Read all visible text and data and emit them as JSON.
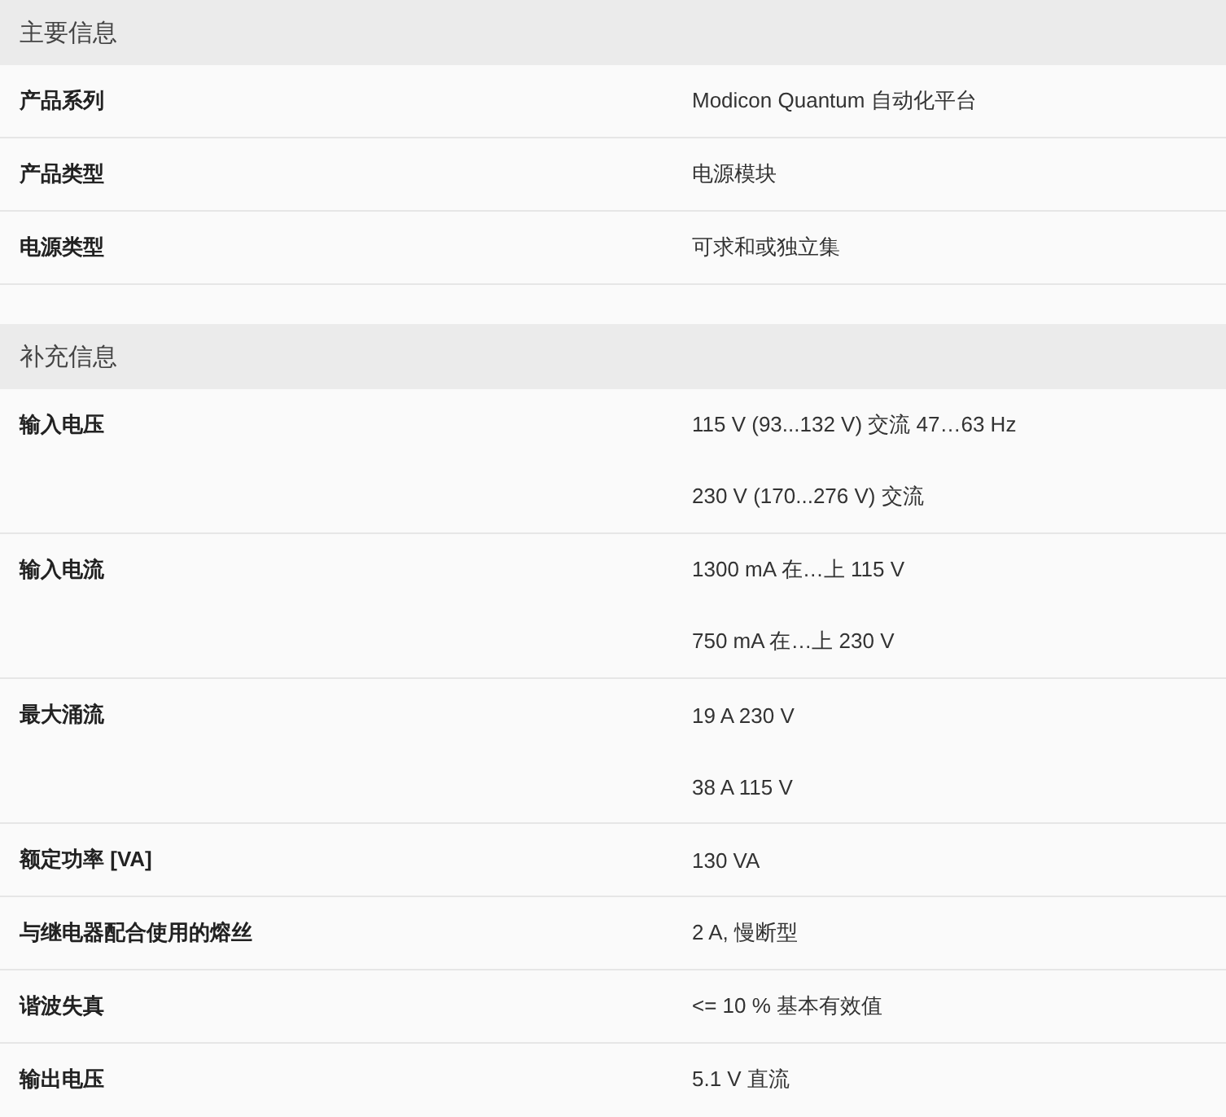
{
  "sections": [
    {
      "title": "主要信息",
      "rows": [
        {
          "label": "产品系列",
          "values": [
            "Modicon Quantum 自动化平台"
          ]
        },
        {
          "label": "产品类型",
          "values": [
            "电源模块"
          ]
        },
        {
          "label": "电源类型",
          "values": [
            "可求和或独立集"
          ]
        }
      ]
    },
    {
      "title": "补充信息",
      "rows": [
        {
          "label": "输入电压",
          "values": [
            "115 V (93...132 V) 交流 47…63 Hz",
            "230 V (170...276 V) 交流"
          ]
        },
        {
          "label": "输入电流",
          "values": [
            "1300 mA 在…上 115 V",
            "750 mA 在…上 230 V"
          ]
        },
        {
          "label": "最大涌流",
          "values": [
            "19 A 230 V",
            "38 A 115 V"
          ]
        },
        {
          "label": "额定功率 [VA]",
          "values": [
            "130 VA"
          ]
        },
        {
          "label": "与继电器配合使用的熔丝",
          "values": [
            "2 A, 慢断型"
          ]
        },
        {
          "label": "谐波失真",
          "values": [
            "<= 10 % 基本有效值"
          ]
        },
        {
          "label": "输出电压",
          "values": [
            "5.1 V 直流"
          ]
        }
      ]
    }
  ]
}
